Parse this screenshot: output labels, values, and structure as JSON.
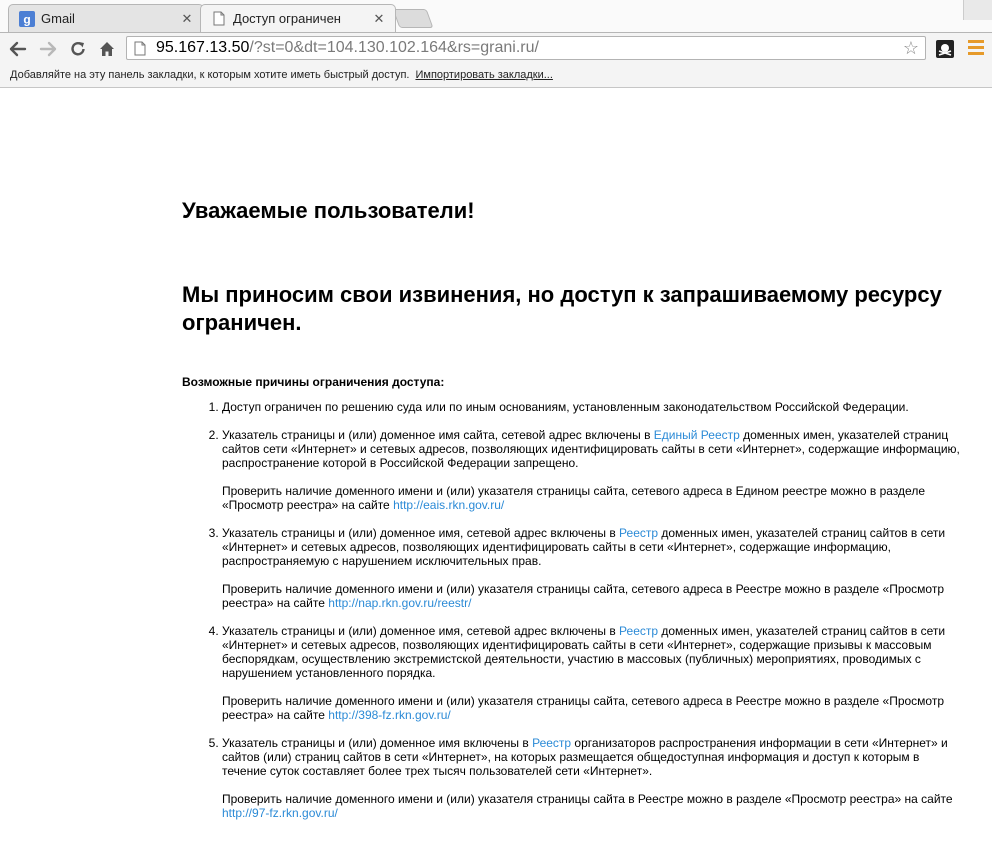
{
  "browser": {
    "tabs": [
      {
        "title": "Gmail",
        "icon": "google-icon",
        "active": false
      },
      {
        "title": "Доступ ограничен",
        "icon": "page-icon",
        "active": true
      }
    ],
    "close_glyph": "✕",
    "url_host": "95.167.13.50",
    "url_rest": "/?st=0&dt=104.130.102.164&rs=grani.ru/",
    "bookmarks_text": "Добавляйте на эту панель закладки, к которым хотите иметь быстрый доступ.",
    "bookmarks_link": "Импортировать закладки..."
  },
  "page": {
    "greeting": "Уважаемые пользователи!",
    "apology": "Мы приносим свои извинения, но доступ к запрашиваемому ресурсу ограничен.",
    "reasons_title": "Возможные причины ограничения доступа:",
    "reasons": [
      {
        "text": "Доступ ограничен  по решению суда или по иным основаниям, установленным законодательством Российской Федерации."
      },
      {
        "text_before": "Указатель страницы и (или) доменное имя сайта, сетевой адрес включены в ",
        "link": "Единый Реестр",
        "text_after": " доменных имен, указателей страниц сайтов сети «Интернет» и сетевых адресов, позволяющих идентифицировать сайты в сети «Интернет», содержащие информацию, распространение которой в Российской Федерации запрещено.",
        "check_text": "Проверить наличие доменного имени и (или) указателя страницы сайта, сетевого адреса в Едином реестре можно в разделе «Просмотр реестра» на сайте ",
        "check_url": "http://eais.rkn.gov.ru/"
      },
      {
        "text_before": "Указатель страницы и (или) доменное имя, сетевой адрес включены в ",
        "link": "Реестр",
        "text_after": " доменных имен, указателей страниц сайтов в сети «Интернет» и сетевых адресов, позволяющих идентифицировать сайты в сети «Интернет», содержащие информацию, распространяемую с нарушением исключительных прав.",
        "check_text": "Проверить наличие доменного имени и (или) указателя страницы сайта, сетевого адреса в Реестре можно в разделе «Просмотр реестра» на сайте ",
        "check_url": "http://nap.rkn.gov.ru/reestr/"
      },
      {
        "text_before": "Указатель страницы и (или) доменное имя, сетевой адрес включены в ",
        "link": "Реестр",
        "text_after": " доменных имен, указателей страниц сайтов в сети «Интернет» и сетевых адресов, позволяющих идентифицировать сайты в сети «Интернет», содержащие призывы к массовым беспорядкам, осуществлению экстремистской деятельности, участию в массовых (публичных) мероприятиях, проводимых с нарушением установленного порядка.",
        "check_text": "Проверить наличие доменного имени и (или) указателя страницы сайта, сетевого адреса в Реестре можно в разделе «Просмотр реестра» на сайте ",
        "check_url": "http://398-fz.rkn.gov.ru/"
      },
      {
        "text_before": "Указатель страницы и (или) доменное имя включены в ",
        "link": "Реестр",
        "text_after": " организаторов распространения информации в сети «Интернет» и сайтов (или) страниц сайтов в сети «Интернет», на которых размещается общедоступная информация и доступ к которым в течение суток составляет более трех тысяч пользователей сети «Интернет».",
        "check_text": "Проверить наличие доменного имени и (или) указателя страницы сайта в Реестре можно в разделе «Просмотр реестра» на сайте ",
        "check_url": "http://97-fz.rkn.gov.ru/"
      }
    ]
  },
  "colors": {
    "link": "#2b8ad6",
    "menu_accent": "#e69a2a"
  }
}
